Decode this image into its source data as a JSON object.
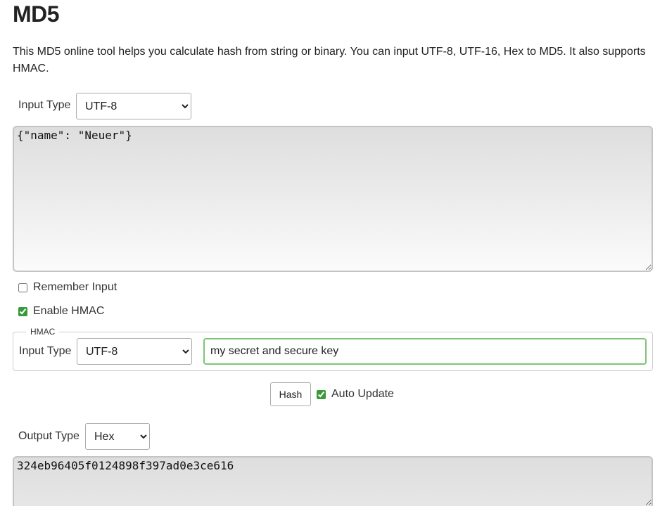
{
  "page": {
    "title": "MD5",
    "description": "This MD5 online tool helps you calculate hash from string or binary. You can input UTF-8, UTF-16, Hex to MD5. It also supports HMAC."
  },
  "input": {
    "type_label": "Input Type",
    "type_selected": "UTF-8",
    "text": "{\"name\": \"Neuer\"}"
  },
  "options": {
    "remember_label": "Remember Input",
    "remember_checked": false,
    "hmac_label": "Enable HMAC",
    "hmac_checked": true
  },
  "hmac": {
    "legend": "HMAC",
    "type_label": "Input Type",
    "type_selected": "UTF-8",
    "key": "my secret and secure key"
  },
  "actions": {
    "hash_label": "Hash",
    "auto_update_label": "Auto Update",
    "auto_update_checked": true
  },
  "output": {
    "type_label": "Output Type",
    "type_selected": "Hex",
    "text": "324eb96405f0124898f397ad0e3ce616"
  },
  "colors": {
    "accent_check": "#3a9a3a",
    "key_border": "#7cc576"
  }
}
